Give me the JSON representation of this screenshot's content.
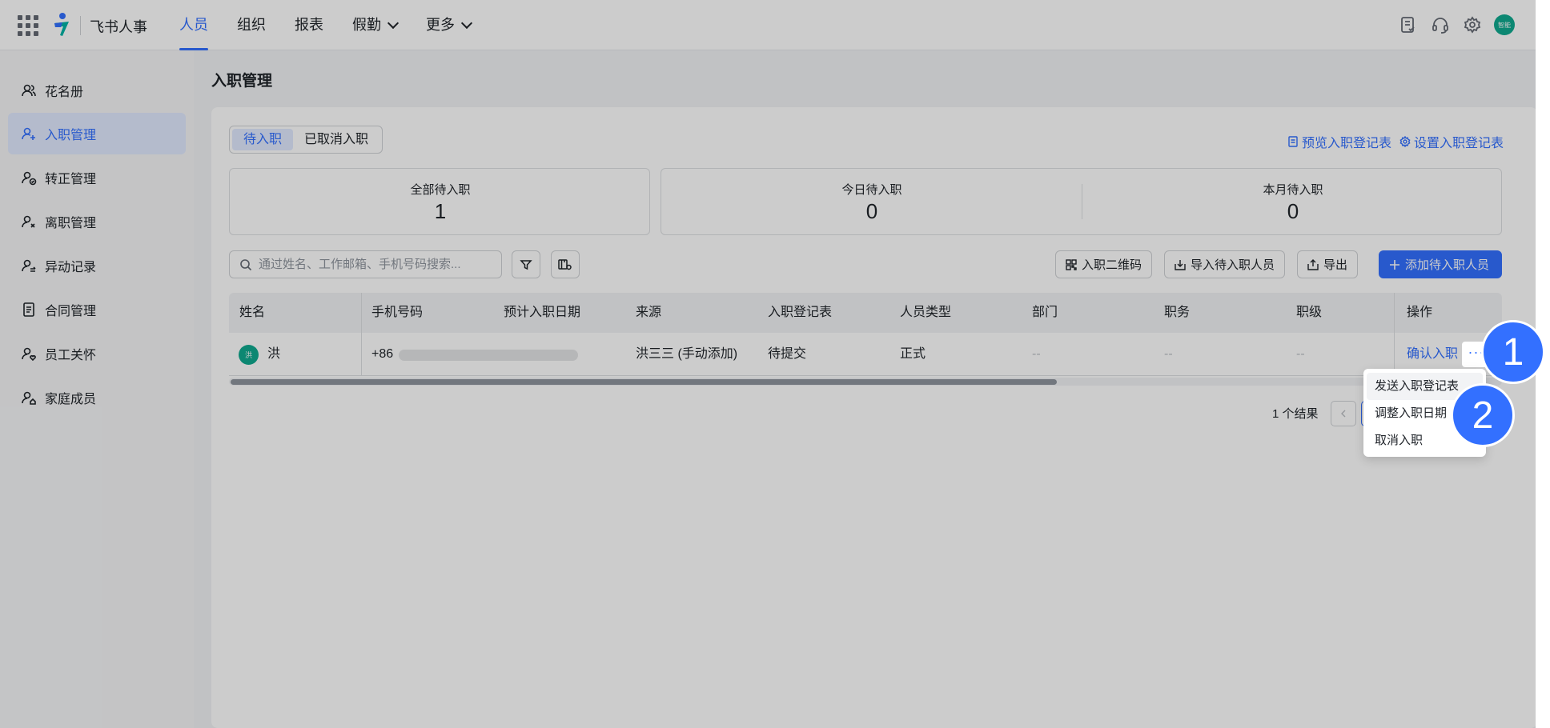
{
  "app": {
    "brand": "飞书人事"
  },
  "nav": {
    "items": [
      {
        "label": "人员"
      },
      {
        "label": "组织"
      },
      {
        "label": "报表"
      },
      {
        "label": "假勤"
      },
      {
        "label": "更多"
      }
    ],
    "avatar_text": "智能"
  },
  "sidebar": {
    "items": [
      {
        "label": "花名册"
      },
      {
        "label": "入职管理"
      },
      {
        "label": "转正管理"
      },
      {
        "label": "离职管理"
      },
      {
        "label": "异动记录"
      },
      {
        "label": "合同管理"
      },
      {
        "label": "员工关怀"
      },
      {
        "label": "家庭成员"
      }
    ]
  },
  "page": {
    "title": "入职管理",
    "tabs": [
      {
        "label": "待入职"
      },
      {
        "label": "已取消入职"
      }
    ],
    "links": {
      "preview": "预览入职登记表",
      "settings": "设置入职登记表"
    },
    "stats": [
      {
        "label": "全部待入职",
        "value": "1"
      },
      {
        "label": "今日待入职",
        "value": "0"
      },
      {
        "label": "本月待入职",
        "value": "0"
      }
    ],
    "search_placeholder": "通过姓名、工作邮箱、手机号码搜索...",
    "buttons": {
      "qrcode": "入职二维码",
      "import": "导入待入职人员",
      "export": "导出",
      "add": "添加待入职人员"
    }
  },
  "table": {
    "columns": [
      "姓名",
      "手机号码",
      "预计入职日期",
      "来源",
      "入职登记表",
      "人员类型",
      "部门",
      "职务",
      "职级",
      "操作"
    ],
    "row": {
      "avatar": "洪",
      "name": "洪",
      "phone_prefix": "+86",
      "source": "洪三三 (手动添加)",
      "form_status": "待提交",
      "type": "正式",
      "dept": "--",
      "job": "--",
      "level": "--",
      "action": "确认入职",
      "more": "···"
    },
    "result_count": "1 个结果"
  },
  "dropdown": {
    "items": [
      {
        "label": "发送入职登记表"
      },
      {
        "label": "调整入职日期"
      },
      {
        "label": "取消入职"
      }
    ]
  },
  "annotations": {
    "badge1": "1",
    "badge2": "2"
  },
  "colors": {
    "accent": "#3370ff",
    "badge": "#3370ff",
    "avatar": "#0fa98f"
  }
}
